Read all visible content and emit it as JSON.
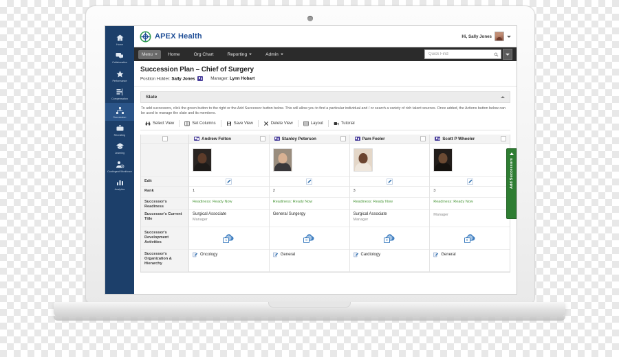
{
  "sidebar": {
    "items": [
      {
        "label": "Home",
        "icon": "home-icon",
        "active": false
      },
      {
        "label": "Collaboration",
        "icon": "chat-icon",
        "active": false
      },
      {
        "label": "Performance",
        "icon": "star-icon",
        "active": false
      },
      {
        "label": "Compensation",
        "icon": "money-list-icon",
        "active": false
      },
      {
        "label": "Succession",
        "icon": "succession-icon",
        "active": true
      },
      {
        "label": "Recruiting",
        "icon": "briefcase-icon",
        "active": false
      },
      {
        "label": "Learning",
        "icon": "graduation-icon",
        "active": false
      },
      {
        "label": "Contingent Workforce",
        "icon": "user-clock-icon",
        "active": false
      },
      {
        "label": "Analytics",
        "icon": "bar-chart-icon",
        "active": false
      }
    ]
  },
  "brandbar": {
    "logo_icon": "apex-health-logo",
    "brand_name": "APEX Health",
    "greeting": "Hi, Sally Jones",
    "avatar_icon": "user-avatar",
    "avatar_caret_icon": "chevron-down-icon"
  },
  "menubar": {
    "menu_label": "Menu",
    "links": [
      {
        "label": "Home",
        "has_caret": false
      },
      {
        "label": "Org Chart",
        "has_caret": false
      },
      {
        "label": "Reporting",
        "has_caret": true
      },
      {
        "label": "Admin",
        "has_caret": true
      }
    ],
    "search_placeholder": "Quick Find",
    "search_value": "",
    "search_icon": "search-icon",
    "search_dropdown_icon": "chevron-down-icon"
  },
  "page": {
    "title": "Succession Plan – Chief of Surgery",
    "position_holder_label": "Position Holder:",
    "position_holder_value": "Sally Jones",
    "manager_label": "Manager:",
    "manager_value": "Lynn Hobart"
  },
  "slate": {
    "section_title": "Slate",
    "collapse_icon": "chevron-up-icon",
    "help_text": "To add successors, click the green button to the right or the Add Successor button below. This will allow you to find a particular individual and / or search a variety of rich talent sources. Once added, the Actions button below can be used to manage the slate and its members.",
    "toolbar": [
      {
        "label": "Select View",
        "icon": "binoculars-icon"
      },
      {
        "label": "Set Columns",
        "icon": "columns-icon"
      },
      {
        "label": "Save View",
        "icon": "save-icon"
      },
      {
        "label": "Delete View",
        "icon": "delete-x-icon"
      },
      {
        "label": "Layout",
        "icon": "layout-grid-icon"
      },
      {
        "label": "Tutorial",
        "icon": "video-camera-icon"
      }
    ]
  },
  "table": {
    "row_labels": [
      "Edit",
      "Rank",
      "Successor's Readiness",
      "Successor's Current Title",
      "Successor's Development Activities",
      "Successor's Organization & Hierarchy"
    ],
    "select_all_checkbox": "unchecked",
    "candidates": [
      {
        "name": "Andrew Felton",
        "badge_icon": "id-badge-icon",
        "checkbox": "unchecked",
        "photo": "photo-andrew-felton",
        "edit_icon": "edit-pencil-icon",
        "rank": "1",
        "readiness": "Readiness: Ready Now",
        "current_title": "Surgical Associate",
        "current_title_sub": "Manager",
        "development_count": "1",
        "development_icon": "development-activities-icon",
        "organization": "Oncology",
        "organization_icon": "org-hierarchy-icon"
      },
      {
        "name": "Stanley Peterson",
        "badge_icon": "id-badge-icon",
        "checkbox": "unchecked",
        "photo": "photo-stanley-peterson",
        "edit_icon": "edit-pencil-icon",
        "rank": "2",
        "readiness": "Readiness: Ready Now",
        "current_title": "General Surgergy",
        "current_title_sub": "",
        "development_count": "0",
        "development_icon": "development-activities-icon",
        "organization": "General",
        "organization_icon": "org-hierarchy-icon"
      },
      {
        "name": "Pam Feeler",
        "badge_icon": "id-badge-icon",
        "checkbox": "unchecked",
        "photo": "photo-pam-feeler",
        "edit_icon": "edit-pencil-icon",
        "rank": "3",
        "readiness": "Readiness: Ready Now",
        "current_title": "Surgical Associate",
        "current_title_sub": "Manager",
        "development_count": "0",
        "development_icon": "development-activities-icon",
        "organization": "Cardiology",
        "organization_icon": "org-hierarchy-icon"
      },
      {
        "name": "Scott P Wheeler",
        "badge_icon": "id-badge-icon",
        "checkbox": "unchecked",
        "photo": "photo-scott-p-wheeler",
        "edit_icon": "edit-pencil-icon",
        "rank": "3",
        "readiness": "Readiness: Ready Now",
        "current_title": "",
        "current_title_sub": "Manager",
        "development_count": "0",
        "development_icon": "development-activities-icon",
        "organization": "General",
        "organization_icon": "org-hierarchy-icon"
      }
    ]
  },
  "add_successors_tab": {
    "label": "Add Successors",
    "arrow_icon": "chevron-up-icon"
  },
  "colors": {
    "sidebar": "#1c3f6a",
    "sidebar_active": "#2a5488",
    "menubar": "#2b2b2b",
    "brand_blue": "#1f4e96",
    "logo_green": "#2e9b4e",
    "readiness_green": "#4e9a3e",
    "add_tab_green": "#2e7d32",
    "icon_blue": "#3f7fc1"
  }
}
